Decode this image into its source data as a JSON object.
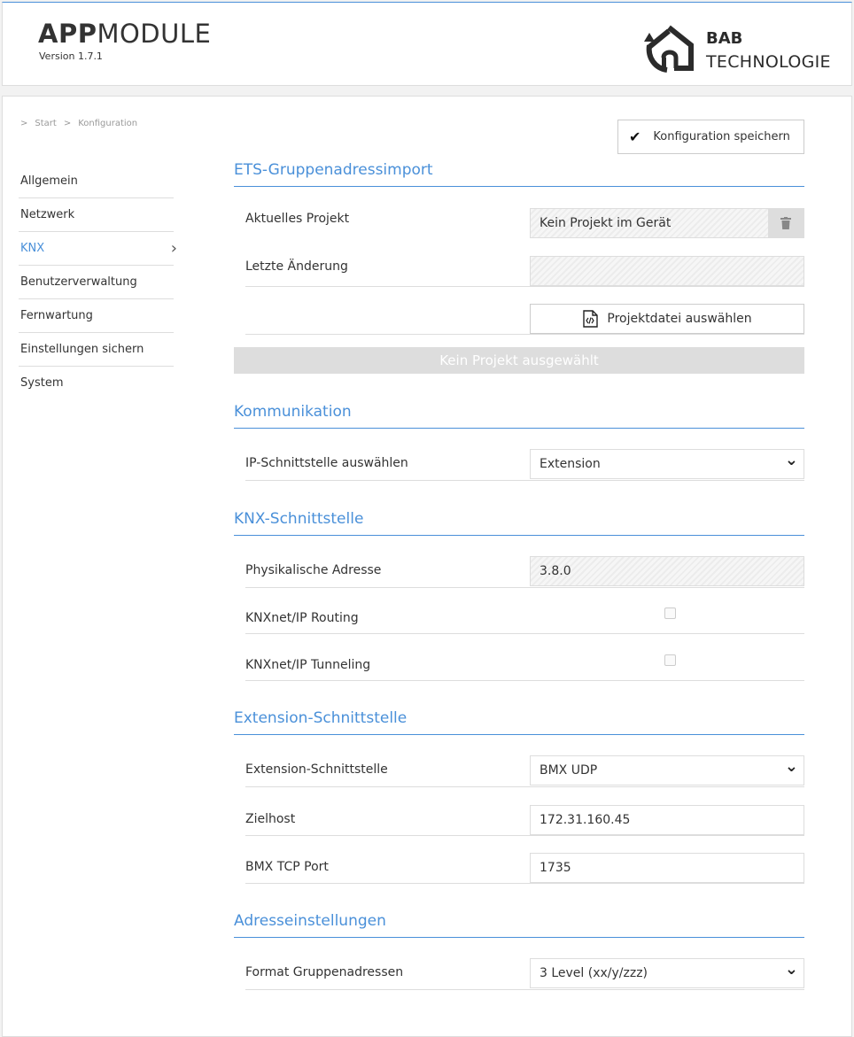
{
  "header": {
    "title_bold": "APP",
    "title_rest": "MODULE",
    "version": "Version 1.7.1",
    "logo_line1": "BAB",
    "logo_line2": "TECHNOLOGIE",
    "accent_color": "#4a90d9"
  },
  "breadcrumb": [
    ">",
    "Start",
    ">",
    "Konfiguration"
  ],
  "sidebar": {
    "items": [
      {
        "label": "Allgemein"
      },
      {
        "label": "Netzwerk"
      },
      {
        "label": "KNX",
        "active": true
      },
      {
        "label": "Benutzerverwaltung"
      },
      {
        "label": "Fernwartung"
      },
      {
        "label": "Einstellungen sichern"
      },
      {
        "label": "System"
      }
    ],
    "active_icon": "chevron-right-icon"
  },
  "toolbar": {
    "save_label": "Konfiguration speichern",
    "save_icon": "checkmark-icon"
  },
  "ets": {
    "title": "ETS-Gruppenadressimport",
    "current_project_label": "Aktuelles Projekt",
    "current_project_value": "Kein Projekt im Gerät",
    "delete_icon": "trash-icon",
    "last_change_label": "Letzte Änderung",
    "last_change_value": "",
    "file_button_label": "Projektdatei auswählen",
    "file_icon": "code-file-icon",
    "upload_label": "Kein Projekt ausgewählt"
  },
  "communication": {
    "title": "Kommunikation",
    "ip_interface_label": "IP-Schnittstelle auswählen",
    "ip_interface_value": "Extension"
  },
  "knx_interface": {
    "title": "KNX-Schnittstelle",
    "physical_address_label": "Physikalische Adresse",
    "physical_address_value": "3.8.0",
    "routing_label": "KNXnet/IP Routing",
    "routing_checked": false,
    "tunneling_label": "KNXnet/IP Tunneling",
    "tunneling_checked": false
  },
  "extension_interface": {
    "title": "Extension-Schnittstelle",
    "interface_label": "Extension-Schnittstelle",
    "interface_value": "BMX UDP",
    "target_host_label": "Zielhost",
    "target_host_value": "172.31.160.45",
    "port_label": "BMX TCP Port",
    "port_value": "1735"
  },
  "address_settings": {
    "title": "Adresseinstellungen",
    "format_label": "Format Gruppenadressen",
    "format_value": "3 Level (xx/y/zzz)"
  }
}
